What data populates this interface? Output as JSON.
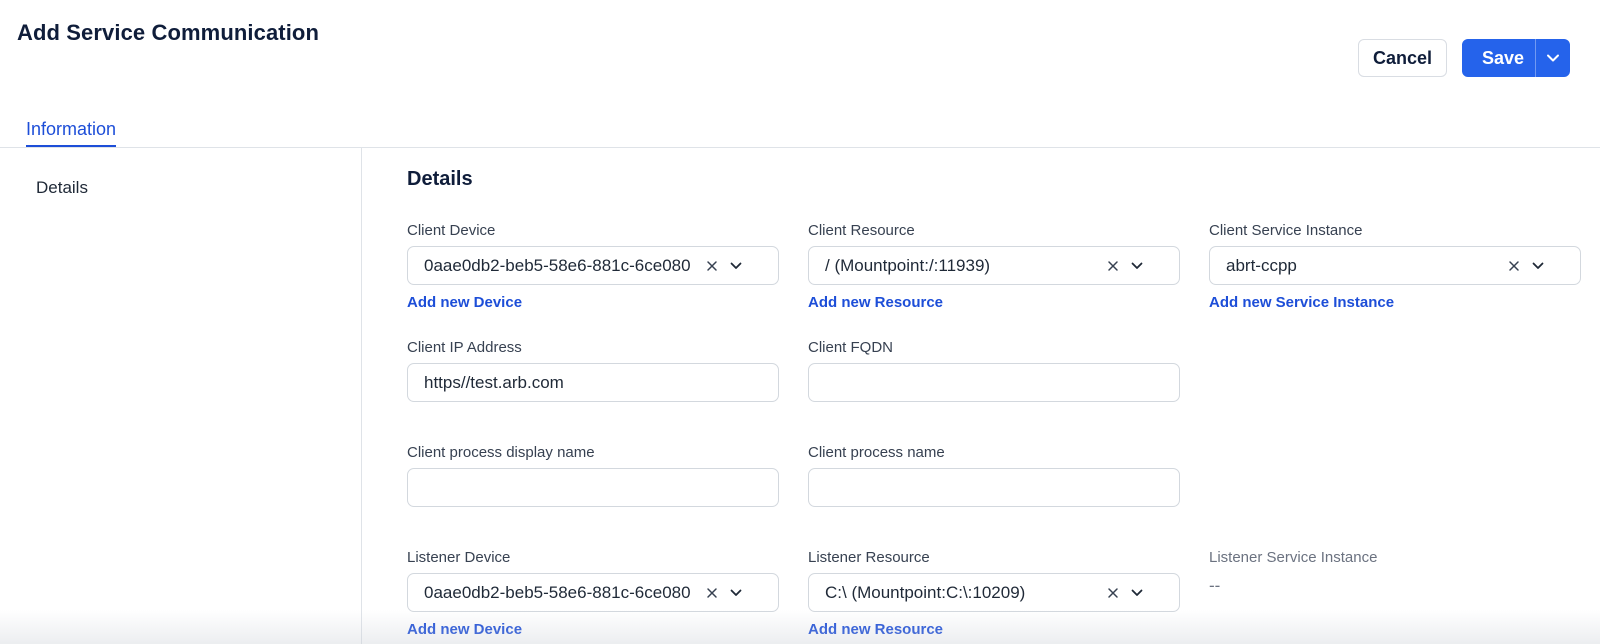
{
  "page": {
    "title": "Add Service Communication"
  },
  "header": {
    "cancel_label": "Cancel",
    "save_label": "Save"
  },
  "tabs": [
    {
      "label": "Information"
    }
  ],
  "sidebar": {
    "items": [
      {
        "label": "Details"
      }
    ]
  },
  "details": {
    "title": "Details",
    "client_device": {
      "label": "Client Device",
      "value": "0aae0db2-beb5-58e6-881c-6ce080",
      "add_link": "Add new Device"
    },
    "client_resource": {
      "label": "Client Resource",
      "value": "/ (Mountpoint:/:11939)",
      "add_link": "Add new Resource"
    },
    "client_service_instance": {
      "label": "Client Service Instance",
      "value": "abrt-ccpp",
      "add_link": "Add new Service Instance"
    },
    "client_ip": {
      "label": "Client IP Address",
      "value": "https//test.arb.com"
    },
    "client_fqdn": {
      "label": "Client FQDN",
      "value": ""
    },
    "client_process_display_name": {
      "label": "Client process display name",
      "value": ""
    },
    "client_process_name": {
      "label": "Client process name",
      "value": ""
    },
    "listener_device": {
      "label": "Listener Device",
      "value": "0aae0db2-beb5-58e6-881c-6ce080",
      "add_link": "Add new Device"
    },
    "listener_resource": {
      "label": "Listener Resource",
      "value": "C:\\ (Mountpoint:C:\\:10209)",
      "add_link": "Add new Resource"
    },
    "listener_service_instance": {
      "label": "Listener Service Instance",
      "value": "--"
    }
  },
  "icons": {
    "clear": "close-icon",
    "dropdown": "chevron-down-icon"
  },
  "colors": {
    "accent": "#2563eb",
    "link": "#1d4ed8",
    "title": "#0f1d3a"
  }
}
